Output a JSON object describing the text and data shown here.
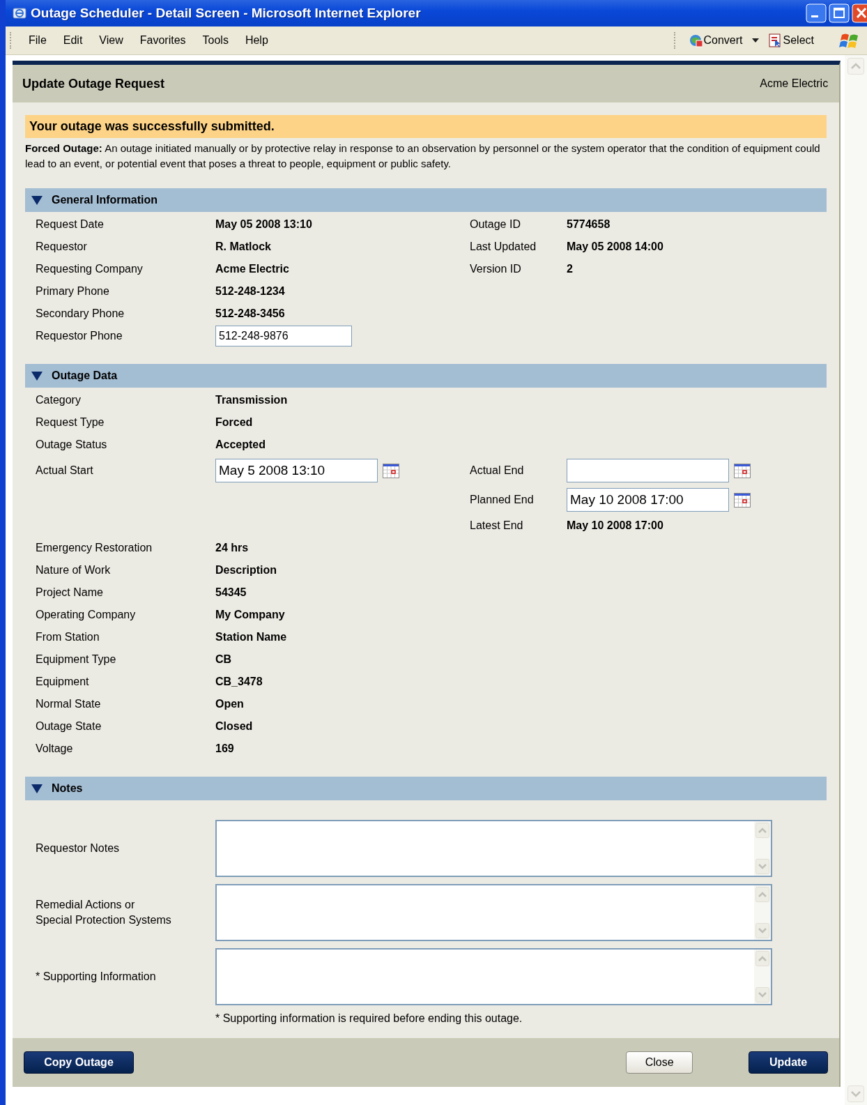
{
  "window": {
    "title": "Outage Scheduler - Detail Screen - Microsoft Internet Explorer"
  },
  "menu": [
    "File",
    "Edit",
    "View",
    "Favorites",
    "Tools",
    "Help"
  ],
  "toolbar": [
    {
      "label": "Convert",
      "kind": "convert"
    },
    {
      "label": "Select",
      "kind": "select"
    }
  ],
  "page": {
    "title": "Update Outage Request",
    "company": "Acme Electric"
  },
  "message": "Your outage was successfully submitted.",
  "definition": "**Forced Outage:**  An outage initiated manually or by protective relay in response to an observation by personnel or the system operator that the condition of equipment could lead to an event, or potential event that poses a threat to people, equipment or public safety.",
  "sections": [
    {
      "title": "General Information",
      "expanded": true,
      "rows": [
        {
          "left": {
            "label": "Request Date",
            "value": "May 05 2008 13:10",
            "kind": "text"
          },
          "right": {
            "label": "Outage ID",
            "value": "5774658",
            "kind": "text"
          }
        },
        {
          "left": {
            "label": "Requestor",
            "value": "R. Matlock",
            "kind": "text"
          },
          "right": {
            "label": "Last Updated",
            "value": "May 05 2008 14:00",
            "kind": "text"
          }
        },
        {
          "left": {
            "label": "Requesting Company",
            "value": "Acme Electric",
            "kind": "text"
          },
          "right": {
            "label": "Version ID",
            "value": "2",
            "kind": "text"
          }
        },
        {
          "left": {
            "label": "Primary Phone",
            "value": "512-248-1234",
            "kind": "text"
          }
        },
        {
          "left": {
            "label": "Secondary Phone",
            "value": "512-248-3456",
            "kind": "text"
          }
        },
        {
          "left": {
            "label": "Requestor Phone",
            "value": "512-248-9876",
            "kind": "input"
          }
        }
      ]
    },
    {
      "title": "Outage Data",
      "expanded": true,
      "rows": [
        {
          "left": {
            "label": "Category",
            "value": "Transmission",
            "kind": "text"
          }
        },
        {
          "left": {
            "label": "Request Type",
            "value": "Forced",
            "kind": "text"
          }
        },
        {
          "left": {
            "label": "Outage Status",
            "value": "Accepted",
            "kind": "text"
          }
        },
        {
          "left": {
            "label": "Actual Start",
            "value": "May 5 2008 13:10",
            "kind": "date"
          },
          "right": {
            "label": "Actual End",
            "kind": "date"
          }
        },
        {
          "right": {
            "label": "Planned End",
            "value": "May 10 2008 17:00",
            "kind": "date"
          }
        },
        {
          "right": {
            "label": "Latest End",
            "value": "May 10 2008 17:00",
            "kind": "text"
          }
        },
        {
          "left": {
            "label": "Emergency Restoration",
            "value": "24 hrs",
            "kind": "text"
          }
        },
        {
          "left": {
            "label": "Nature of Work",
            "value": "Description",
            "kind": "text"
          }
        },
        {
          "left": {
            "label": "Project Name",
            "value": "54345",
            "kind": "text"
          }
        },
        {
          "left": {
            "label": "Operating Company",
            "value": "My Company",
            "kind": "text"
          }
        },
        {
          "left": {
            "label": "From Station",
            "value": "Station Name",
            "kind": "text"
          }
        },
        {
          "left": {
            "label": "Equipment Type",
            "value": "CB",
            "kind": "text"
          }
        },
        {
          "left": {
            "label": "Equipment",
            "value": "CB_3478",
            "kind": "text"
          }
        },
        {
          "left": {
            "label": "Normal State",
            "value": "Open",
            "kind": "text"
          }
        },
        {
          "left": {
            "label": "Outage State",
            "value": "Closed",
            "kind": "text"
          }
        },
        {
          "left": {
            "label": "Voltage",
            "value": "169",
            "kind": "text"
          }
        }
      ]
    },
    {
      "title": "Notes",
      "expanded": true,
      "rows": [
        {
          "left": {
            "label": "Requestor Notes",
            "kind": "textarea"
          }
        },
        {
          "left": {
            "label": "Remedial Actions or\nSpecial Protection Systems",
            "kind": "textarea"
          }
        },
        {
          "left": {
            "label": "* Supporting Information",
            "kind": "textarea"
          }
        }
      ],
      "footnote": "* Supporting information is required before ending this outage."
    }
  ],
  "buttons": [
    {
      "label": "Copy Outage",
      "kind": "primary"
    },
    {
      "label": "Close",
      "kind": "secondary"
    },
    {
      "label": "Update",
      "kind": "primary"
    }
  ]
}
